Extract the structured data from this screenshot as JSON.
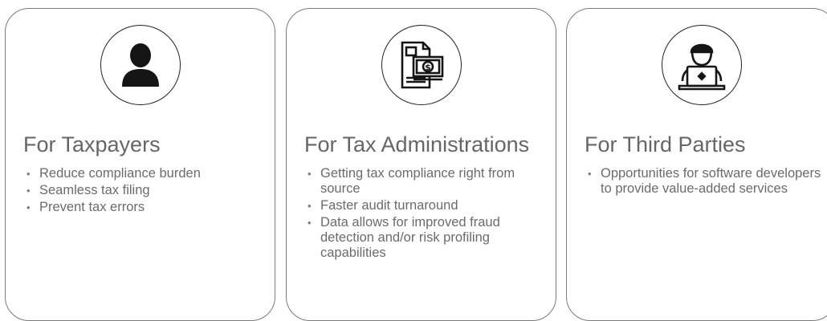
{
  "cards": [
    {
      "icon": "person-icon",
      "title": "For Taxpayers",
      "bullets": [
        "Reduce compliance burden",
        "Seamless tax filing",
        "Prevent tax errors"
      ]
    },
    {
      "icon": "tax-document-money-icon",
      "title": "For Tax Administrations",
      "bullets": [
        "Getting tax compliance right from source",
        "Faster audit turnaround",
        "Data allows for improved fraud detection and/or risk profiling capabilities"
      ]
    },
    {
      "icon": "developer-laptop-icon",
      "title": "For Third Parties",
      "bullets": [
        "Opportunities for software developers to provide value-added services"
      ]
    }
  ],
  "colors": {
    "border": "#7a7a7a",
    "icon": "#222222",
    "text": "#666666"
  }
}
